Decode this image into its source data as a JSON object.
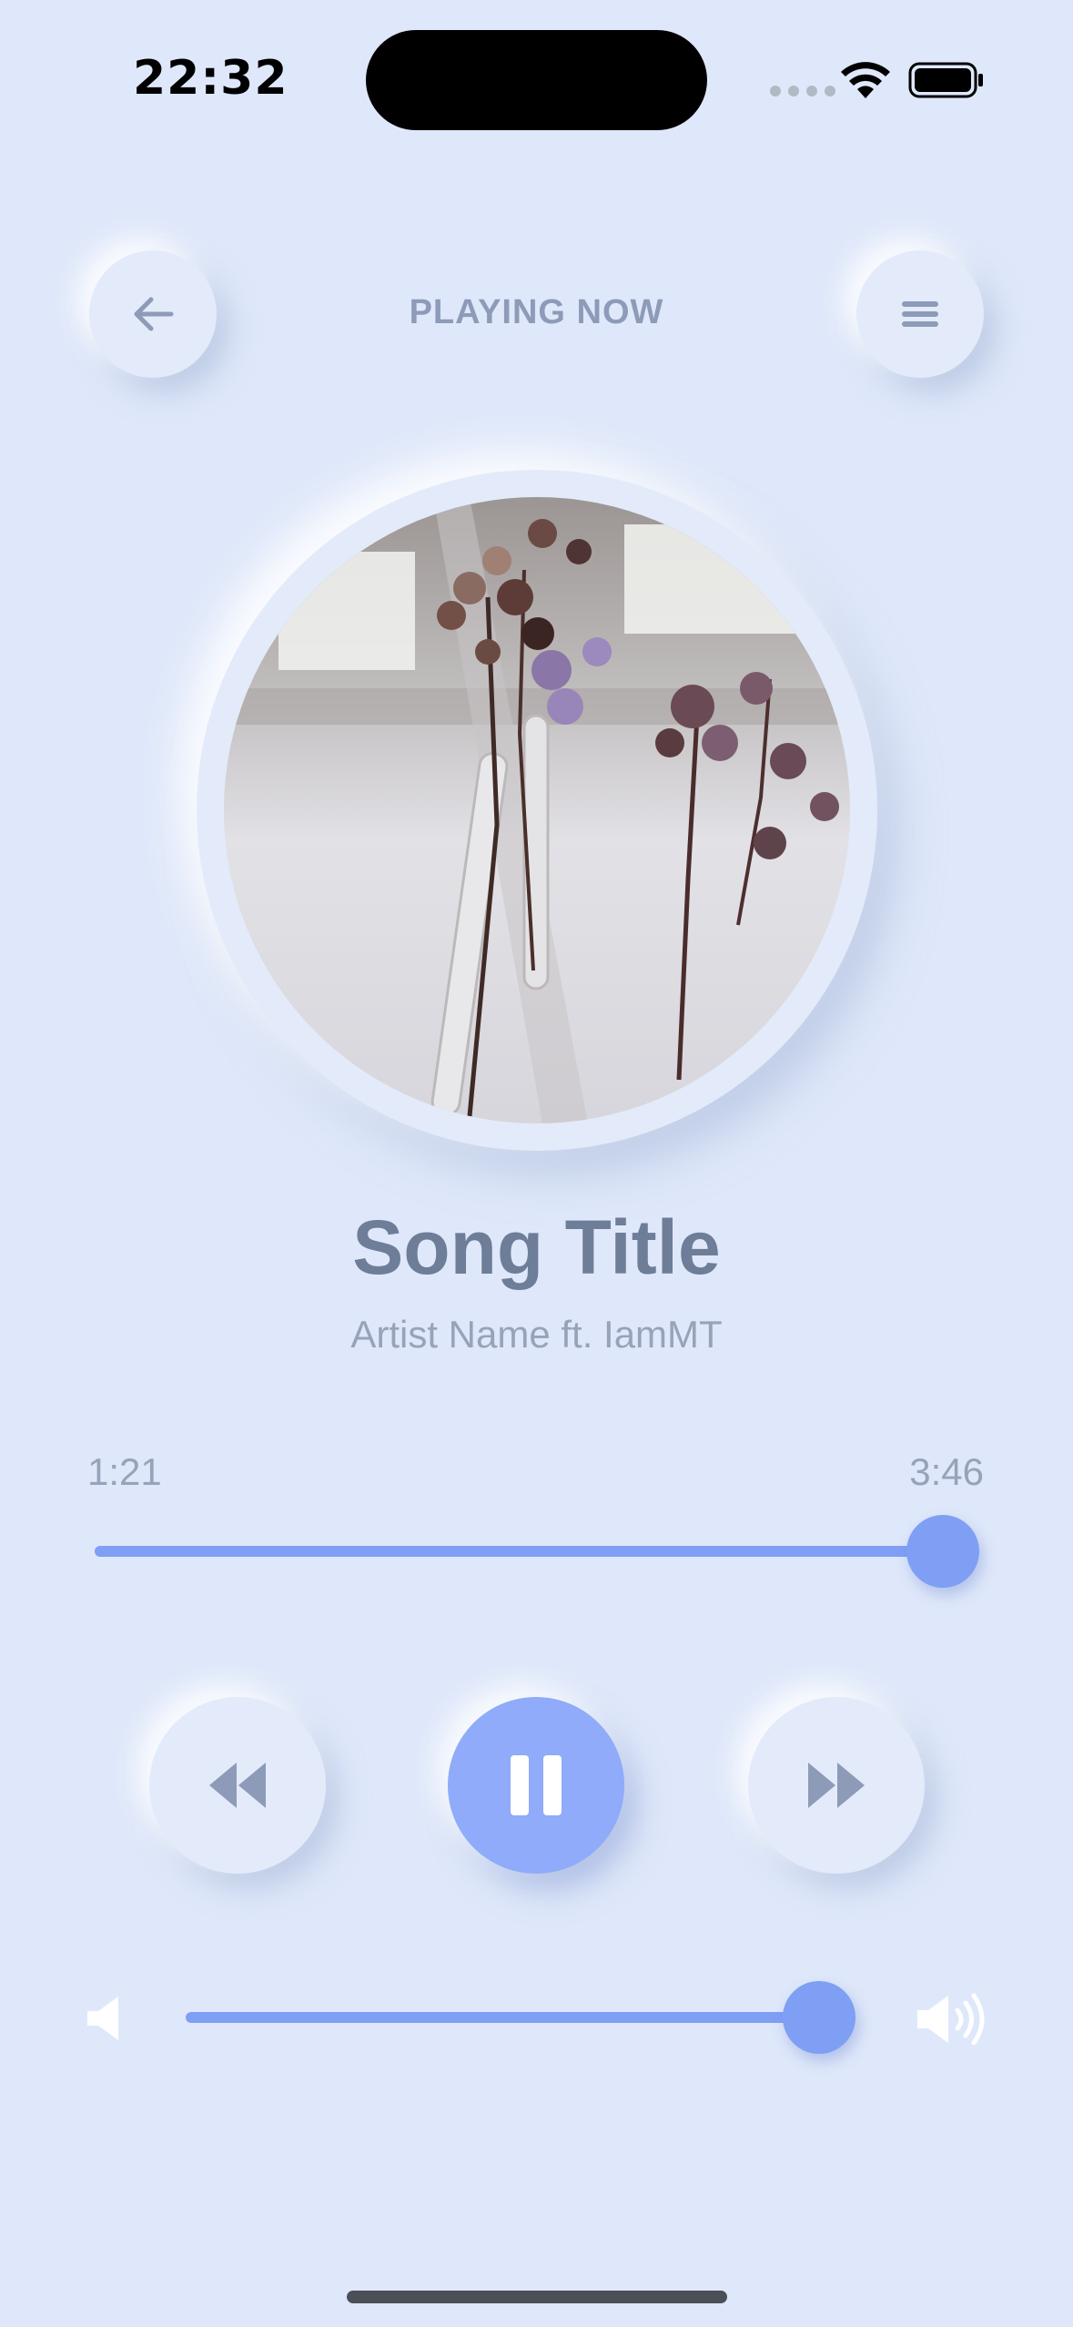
{
  "status_bar": {
    "time": "22:32"
  },
  "header": {
    "title": "PLAYING NOW",
    "back_icon": "arrow-left-icon",
    "menu_icon": "hamburger-menu-icon"
  },
  "track": {
    "title": "Song Title",
    "artist": "Artist Name ft. IamMT"
  },
  "progress": {
    "elapsed": "1:21",
    "total": "3:46",
    "position_fraction": 1.0
  },
  "controls": {
    "rewind_icon": "rewind-icon",
    "play_pause_icon": "pause-icon",
    "fast_forward_icon": "fast-forward-icon"
  },
  "volume": {
    "level_fraction": 1.0,
    "low_icon": "volume-low-icon",
    "high_icon": "volume-high-icon"
  },
  "colors": {
    "background": "#dfe8fa",
    "accent": "#7f9ff5",
    "play_button": "#8fabf9",
    "text_primary": "#6e7d98",
    "text_secondary": "#97a3ba"
  }
}
